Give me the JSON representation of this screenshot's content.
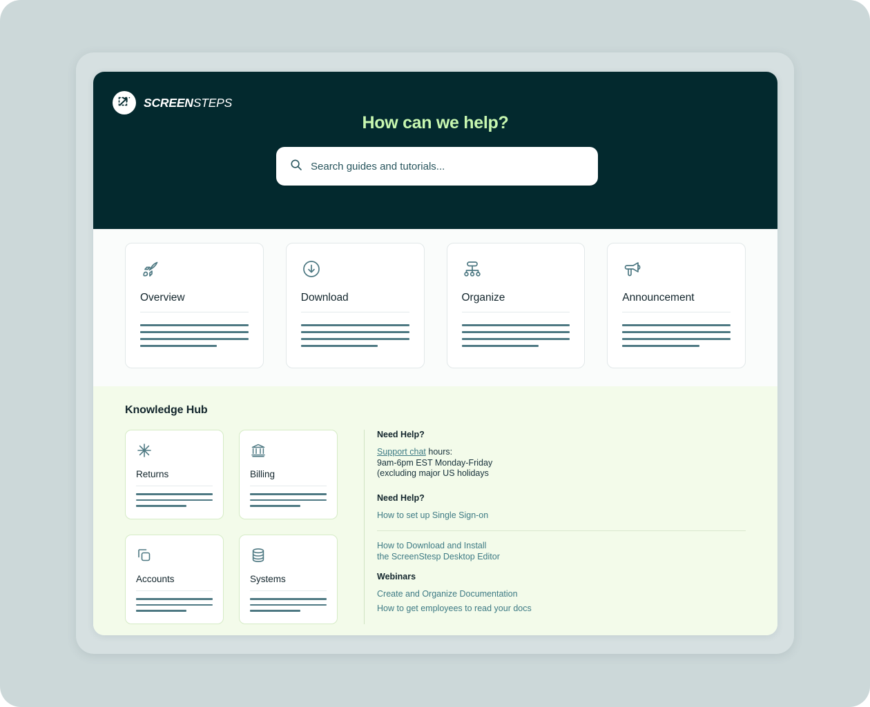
{
  "brand": {
    "logo_icon": "screensteps-circle-arrow-icon",
    "name_bold": "SCREEN",
    "name_light": "STEPS"
  },
  "hero": {
    "title": "How can we help?",
    "search": {
      "icon": "search-icon",
      "placeholder": "Search guides and tutorials...",
      "value": ""
    },
    "bg_color": "#03292e",
    "title_color": "#c8f7b0"
  },
  "top_cards": [
    {
      "title": "Overview",
      "icon": "rocket-icon",
      "lines": 4
    },
    {
      "title": "Download",
      "icon": "download-circle-icon",
      "lines": 4
    },
    {
      "title": "Organize",
      "icon": "org-chart-icon",
      "lines": 4
    },
    {
      "title": "Announcement",
      "icon": "megaphone-icon",
      "lines": 4
    }
  ],
  "knowledge_hub": {
    "title": "Knowledge Hub",
    "bg_color": "#f3fbea",
    "cards": [
      {
        "title": "Returns",
        "icon": "asterisk-icon",
        "lines": 3
      },
      {
        "title": "Billing",
        "icon": "bank-icon",
        "lines": 3
      },
      {
        "title": "Accounts",
        "icon": "copy-layers-icon",
        "lines": 3
      },
      {
        "title": "Systems",
        "icon": "database-icon",
        "lines": 3
      }
    ],
    "help": {
      "heading_1": "Need Help?",
      "support_link": "Support chat",
      "support_suffix": " hours:",
      "hours_line_1": "9am-6pm EST Monday-Friday",
      "hours_line_2": "(excluding major US holidays",
      "heading_2": "Need Help?",
      "link_sso": "How to set up Single Sign-on",
      "link_download_1": "How to Download and Install",
      "link_download_2": "the ScreenStesp Desktop Editor",
      "heading_3": "Webinars",
      "link_webinar_1": "Create and Organize Documentation",
      "link_webinar_2": "How to get employees to read your docs",
      "link_color": "#3d7a84"
    }
  }
}
